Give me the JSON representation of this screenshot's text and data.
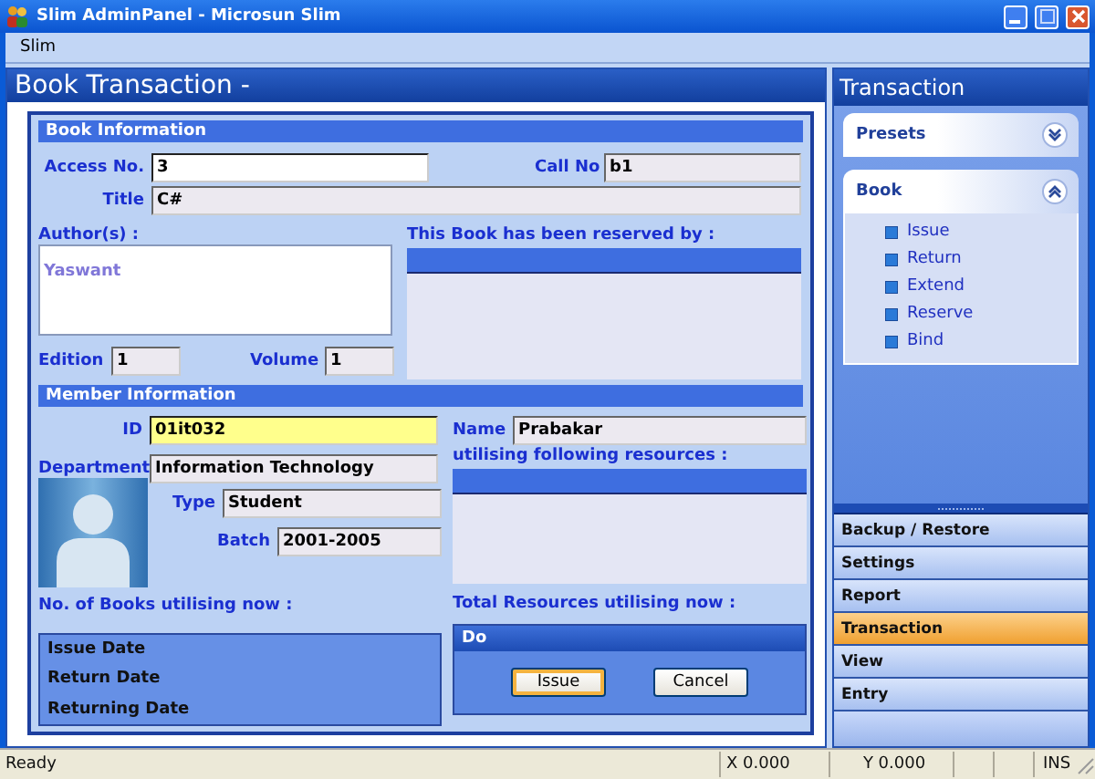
{
  "window": {
    "title": "Slim AdminPanel - Microsun Slim"
  },
  "menu": [
    "Slim"
  ],
  "page_title": "Book Transaction -",
  "book_info": {
    "heading": "Book Information",
    "access_no": {
      "label": "Access No.",
      "value": "3",
      "readonly": false,
      "focused": false
    },
    "call_no": {
      "label": "Call No",
      "value": "b1",
      "readonly": true,
      "focused": false
    },
    "title": {
      "label": "Title",
      "value": "C#",
      "readonly": true,
      "focused": false
    },
    "authors": {
      "label": "Author(s) :",
      "items": [
        "Yaswant"
      ]
    },
    "reserved": {
      "label": "This Book has been reserved by :"
    },
    "edition": {
      "label": "Edition",
      "value": "1",
      "readonly": true,
      "focused": false
    },
    "volume": {
      "label": "Volume",
      "value": "1",
      "readonly": true,
      "focused": false
    }
  },
  "member_info": {
    "heading": "Member Information",
    "id": {
      "label": "ID",
      "value": "01it032",
      "readonly": false,
      "focused": true
    },
    "department": {
      "label": "Department",
      "value": "Information Technology",
      "readonly": true,
      "focused": false
    },
    "type": {
      "label": "Type",
      "value": "Student",
      "readonly": true,
      "focused": false
    },
    "batch": {
      "label": "Batch",
      "value": "2001-2005",
      "readonly": true,
      "focused": false
    },
    "name": {
      "label": "Name",
      "value": "Prabakar",
      "readonly": true,
      "focused": false
    },
    "resources": {
      "label": "utilising following resources :"
    },
    "books_count_label": "No. of Books utilising now :",
    "total_resources_label": "Total Resources utilising now :",
    "dates": [
      "Issue Date",
      "Return Date",
      "Returning Date"
    ],
    "do_panel": {
      "title": "Do",
      "buttons": [
        {
          "label": "Issue",
          "default": true
        },
        {
          "label": "Cancel",
          "default": false
        }
      ]
    }
  },
  "side": {
    "title": "Transaction",
    "groups": [
      {
        "title": "Presets",
        "expanded": false
      },
      {
        "title": "Book",
        "expanded": true,
        "items": [
          "Issue",
          "Return",
          "Extend",
          "Reserve",
          "Bind"
        ]
      }
    ],
    "nav": [
      {
        "label": "Backup / Restore",
        "selected": false
      },
      {
        "label": "Settings",
        "selected": false
      },
      {
        "label": "Report",
        "selected": false
      },
      {
        "label": "Transaction",
        "selected": true
      },
      {
        "label": "View",
        "selected": false
      },
      {
        "label": "Entry",
        "selected": false
      }
    ]
  },
  "status_bar": {
    "message": "Ready",
    "x": "X 0.000",
    "y": "Y 0.000",
    "mode": "INS"
  }
}
